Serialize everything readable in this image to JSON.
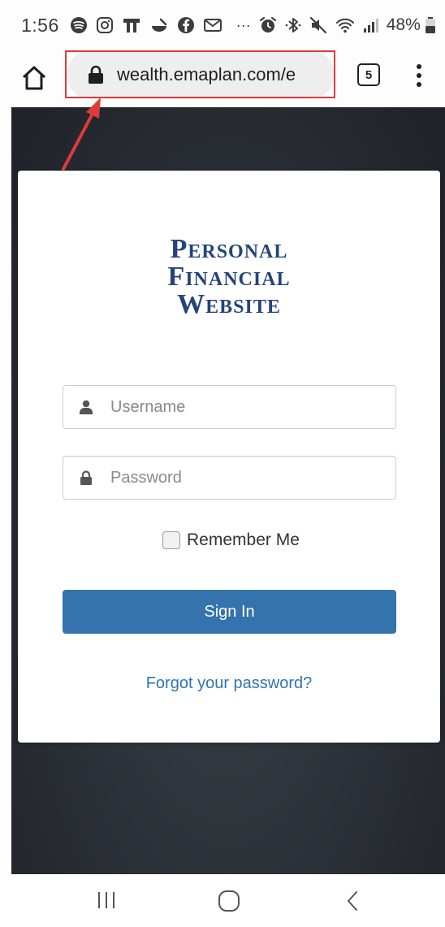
{
  "status_bar": {
    "time": "1:56",
    "battery": "48%",
    "icons": [
      "spotify-icon",
      "instagram-icon",
      "notification-icon",
      "delivery-icon",
      "facebook-icon",
      "gmail-icon",
      "more-icon",
      "alarm-icon",
      "bluetooth-icon",
      "mute-icon",
      "wifi-icon",
      "signal-icon",
      "battery-icon"
    ],
    "more_glyph": "···"
  },
  "browser": {
    "url": "wealth.emaplan.com/e",
    "tab_count": "5"
  },
  "login": {
    "logo_lines": [
      "Personal",
      "Financial",
      "Website"
    ],
    "username_placeholder": "Username",
    "password_placeholder": "Password",
    "remember_label": "Remember Me",
    "signin_label": "Sign In",
    "forgot_label": "Forgot your password?"
  },
  "colors": {
    "brand": "#24447a",
    "primary_button": "#3473ad",
    "link": "#2f74b5",
    "annotation": "#e03a3a"
  }
}
